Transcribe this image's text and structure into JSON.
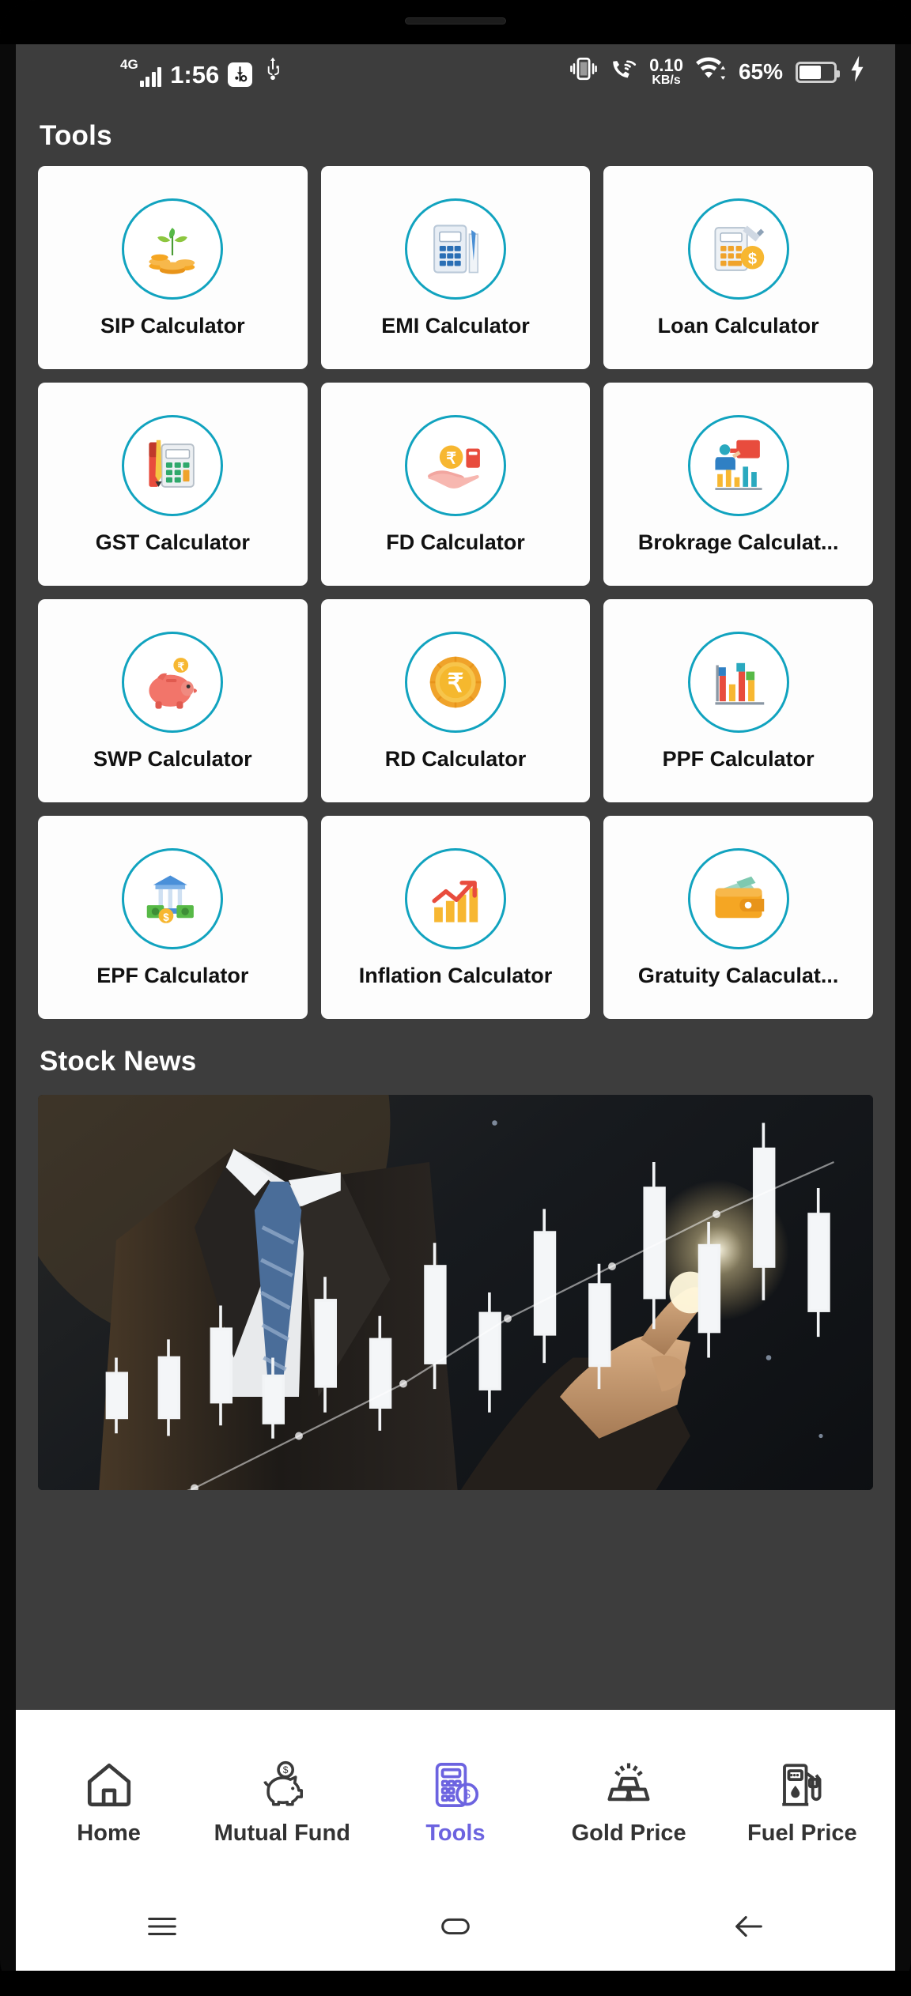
{
  "status_bar": {
    "network_type": "4G",
    "signal_icon": "signal-bars-icon",
    "time": "1:56",
    "usb_debug_icon": "usb-debug-icon",
    "usb_icon": "usb-icon",
    "vibrate_icon": "vibrate-icon",
    "vowifi_icon": "vowifi-call-icon",
    "network_speed_value": "0.10",
    "network_speed_unit": "KB/s",
    "wifi_icon": "wifi-icon",
    "battery_percent": "65%",
    "battery_icon": "battery-icon",
    "charging_icon": "charging-bolt-icon"
  },
  "sections": {
    "tools_title": "Tools",
    "stock_news_title": "Stock News"
  },
  "tools": [
    {
      "label": "SIP Calculator",
      "icon": "sip-growth-plant-coins-icon"
    },
    {
      "label": "EMI Calculator",
      "icon": "emi-calculator-document-icon"
    },
    {
      "label": "Loan Calculator",
      "icon": "loan-calculator-dollar-icon"
    },
    {
      "label": "GST Calculator",
      "icon": "gst-calculator-pencil-icon"
    },
    {
      "label": "FD Calculator",
      "icon": "fd-hand-rupee-coin-icon"
    },
    {
      "label": "Brokrage Calculat...",
      "icon": "brokerage-chart-person-icon"
    },
    {
      "label": "SWP Calculator",
      "icon": "swp-piggy-bank-icon"
    },
    {
      "label": "RD Calculator",
      "icon": "rd-rupee-coin-icon"
    },
    {
      "label": "PPF Calculator",
      "icon": "ppf-bar-chart-icon"
    },
    {
      "label": "EPF Calculator",
      "icon": "epf-bank-money-icon"
    },
    {
      "label": "Inflation Calculator",
      "icon": "inflation-arrow-bars-icon"
    },
    {
      "label": "Gratuity Calaculat...",
      "icon": "gratuity-wallet-icon"
    }
  ],
  "stock_news": {
    "image_alt": "businessman touching rising candlestick stock chart"
  },
  "bottom_nav": {
    "active": "Tools",
    "items": [
      {
        "label": "Home",
        "icon": "home-icon"
      },
      {
        "label": "Mutual Fund",
        "icon": "piggy-bank-dollar-icon"
      },
      {
        "label": "Tools",
        "icon": "calculator-dollar-icon"
      },
      {
        "label": "Gold Price",
        "icon": "gold-bars-icon"
      },
      {
        "label": "Fuel Price",
        "icon": "fuel-pump-icon"
      }
    ]
  },
  "system_nav": {
    "recents_icon": "recents-menu-icon",
    "home_icon": "home-pill-icon",
    "back_icon": "back-arrow-icon"
  },
  "colors": {
    "app_background": "#3d3d3d",
    "card_background": "#fdfdfd",
    "icon_ring": "#11a3bf",
    "nav_active": "#6c63e0",
    "status_text": "#ffffff"
  }
}
